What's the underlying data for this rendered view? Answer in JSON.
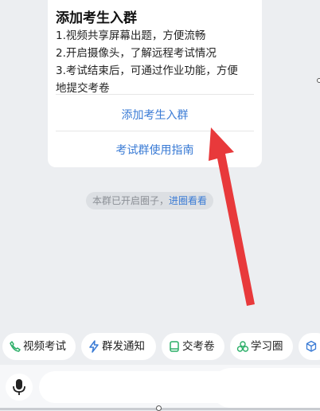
{
  "card": {
    "title": "添加考生入群",
    "lines": [
      "1.视频共享屏幕出题，方便流畅",
      "2.开启摄像头，了解远程考试情况",
      "3.考试结束后，可通过作业功能，方便",
      "地提交考卷"
    ],
    "primary_action": "添加考生入群",
    "secondary_action": "考试群使用指南"
  },
  "notice": {
    "text": "本群已开启圈子，",
    "link": "进圈看看"
  },
  "quick_actions": [
    {
      "label": "视频考试",
      "icon": "phone-icon"
    },
    {
      "label": "群发通知",
      "icon": "lightning-icon"
    },
    {
      "label": "交考卷",
      "icon": "notebook-icon"
    },
    {
      "label": "学习圈",
      "icon": "circles-icon"
    },
    {
      "label": "",
      "icon": "cube-plus-icon"
    }
  ],
  "input": {
    "placeholder": ""
  },
  "colors": {
    "accent": "#3a7bd5",
    "green": "#2aae67",
    "arrow": "#e8393b"
  }
}
